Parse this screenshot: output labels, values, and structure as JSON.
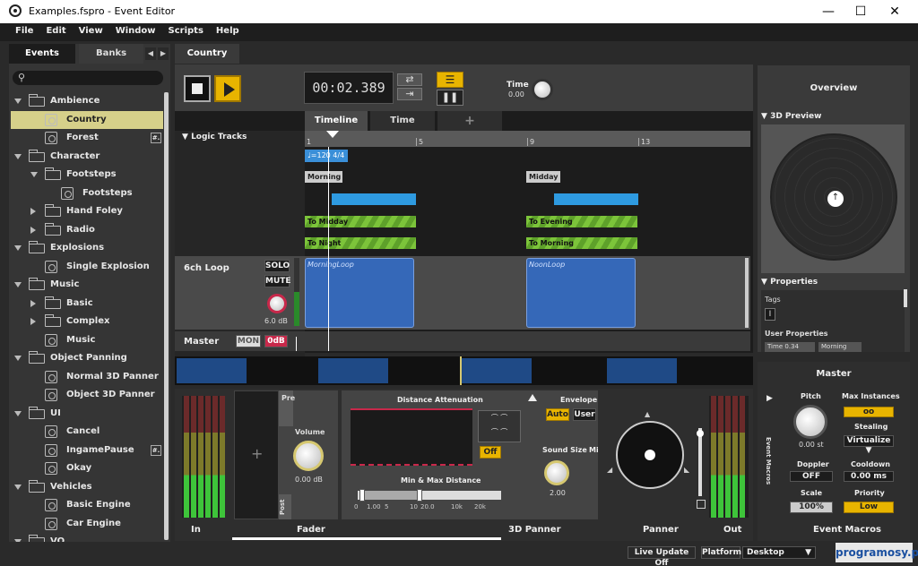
{
  "window": {
    "title": "Examples.fspro - Event Editor",
    "minimize": "—",
    "maximize": "☐",
    "close": "✕"
  },
  "menu": [
    "File",
    "Edit",
    "View",
    "Window",
    "Scripts",
    "Help"
  ],
  "left_tabs": {
    "events": "Events",
    "banks": "Banks"
  },
  "tree": [
    {
      "label": "Ambience",
      "type": "folder",
      "level": 0,
      "open": true
    },
    {
      "label": "Country",
      "type": "event",
      "level": 1,
      "selected": true
    },
    {
      "label": "Forest",
      "type": "event",
      "level": 1,
      "badge": "#."
    },
    {
      "label": "Character",
      "type": "folder",
      "level": 0,
      "open": true
    },
    {
      "label": "Footsteps",
      "type": "folder",
      "level": 1,
      "open": true
    },
    {
      "label": "Footsteps",
      "type": "event",
      "level": 2
    },
    {
      "label": "Hand Foley",
      "type": "folder",
      "level": 1,
      "open": false
    },
    {
      "label": "Radio",
      "type": "folder",
      "level": 1,
      "open": false
    },
    {
      "label": "Explosions",
      "type": "folder",
      "level": 0,
      "open": true
    },
    {
      "label": "Single Explosion",
      "type": "event",
      "level": 1
    },
    {
      "label": "Music",
      "type": "folder",
      "level": 0,
      "open": true
    },
    {
      "label": "Basic",
      "type": "folder",
      "level": 1,
      "open": false
    },
    {
      "label": "Complex",
      "type": "folder",
      "level": 1,
      "open": false
    },
    {
      "label": "Music",
      "type": "event",
      "level": 1
    },
    {
      "label": "Object Panning",
      "type": "folder",
      "level": 0,
      "open": true
    },
    {
      "label": "Normal 3D Panner",
      "type": "event",
      "level": 1
    },
    {
      "label": "Object 3D Panner",
      "type": "event",
      "level": 1
    },
    {
      "label": "UI",
      "type": "folder",
      "level": 0,
      "open": true
    },
    {
      "label": "Cancel",
      "type": "event",
      "level": 1
    },
    {
      "label": "IngamePause",
      "type": "event",
      "level": 1,
      "badge": "#."
    },
    {
      "label": "Okay",
      "type": "event",
      "level": 1
    },
    {
      "label": "Vehicles",
      "type": "folder",
      "level": 0,
      "open": true
    },
    {
      "label": "Basic Engine",
      "type": "event",
      "level": 1
    },
    {
      "label": "Car Engine",
      "type": "event",
      "level": 1
    },
    {
      "label": "VO",
      "type": "folder",
      "level": 0,
      "open": true
    }
  ],
  "editor_tab": "Country",
  "transport": {
    "time": "00:02.389",
    "time_label": "Time",
    "time_value": "0.00"
  },
  "timeline_tabs": {
    "timeline": "Timeline",
    "time": "Time",
    "add": "+"
  },
  "logic_tracks": "Logic Tracks",
  "ruler": [
    "1",
    "5",
    "9",
    "13"
  ],
  "tempo": "♩=120 4/4",
  "markers": {
    "morning": "Morning",
    "midday": "Midday"
  },
  "transitions": {
    "to_midday": "To Midday",
    "to_night": "To Night",
    "to_evening": "To Evening",
    "to_morning": "To Morning"
  },
  "track": {
    "name": "6ch Loop",
    "solo": "SOLO",
    "mute": "MUTE",
    "db": "6.0 dB",
    "clip1": "MorningLoop",
    "clip2": "NoonLoop"
  },
  "master_track": {
    "name": "Master",
    "mon": "MON",
    "db": "0dB"
  },
  "overview": {
    "title": "Overview",
    "preview": "3D Preview",
    "properties": "Properties",
    "tags": "Tags",
    "tag_icon": "I",
    "user_props": "User Properties",
    "prop1": "Time 0.34",
    "prop2": "Morning"
  },
  "deck": {
    "in": "In",
    "fader": "Fader",
    "pre": "Pre",
    "post": "Post",
    "volume": "Volume",
    "volume_value": "0.00 dB",
    "add": "+",
    "distance": "Distance Attenuation",
    "off": "Off",
    "minmax": "Min & Max Distance",
    "envelope": "Envelope",
    "auto": "Auto",
    "user": "User",
    "sound_size": "Sound Size",
    "sound_size_value": "2.00",
    "mi": "Mi",
    "scale": [
      "0",
      "1.00",
      "5",
      "10",
      "20.0",
      "10k",
      "20k"
    ],
    "panner3d": "3D Panner",
    "panner": "Panner",
    "out": "Out"
  },
  "macros": {
    "title": "Master",
    "pitch": "Pitch",
    "pitch_value": "0.00 st",
    "max_instances": "Max Instances",
    "max_value": "oo",
    "stealing": "Stealing",
    "stealing_value": "Virtualize",
    "doppler": "Doppler",
    "doppler_value": "OFF",
    "cooldown": "Cooldown",
    "cooldown_value": "0.00 ms",
    "scale": "Scale",
    "scale_value": "100%",
    "priority": "Priority",
    "priority_value": "Low",
    "event_macros": "Event Macros",
    "footer": "Event Macros"
  },
  "statusbar": {
    "live": "Live Update Off",
    "platform": "Platform",
    "platform_value": "Desktop",
    "watermark": "programosy.pl"
  }
}
